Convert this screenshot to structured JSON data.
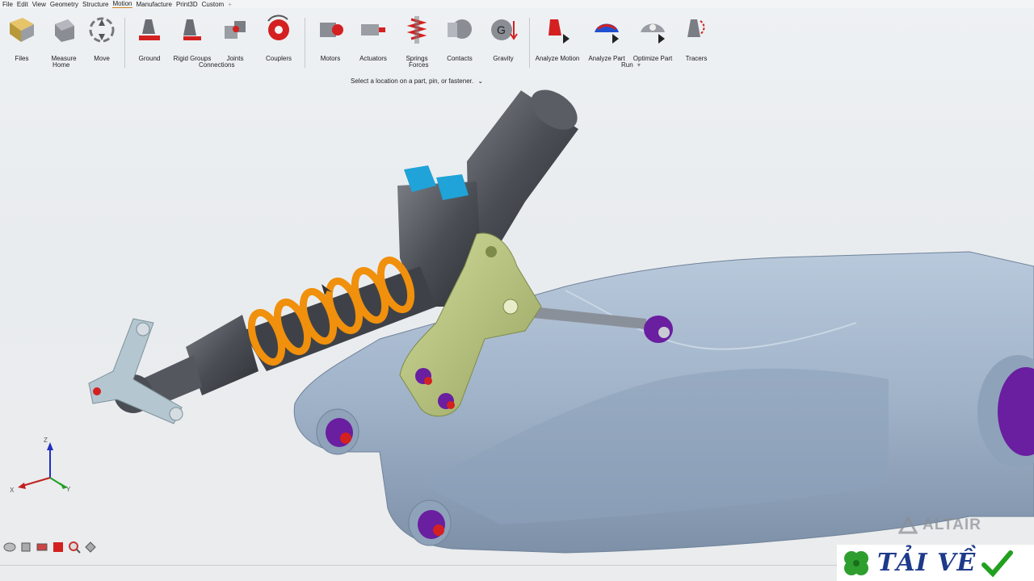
{
  "menu": [
    "File",
    "Edit",
    "View",
    "Geometry",
    "Structure",
    "Motion",
    "Manufacture",
    "Print3D",
    "Custom",
    "+"
  ],
  "active_menu": "Motion",
  "ribbon": {
    "tools": [
      {
        "label": "Files",
        "icon": "files-icon"
      },
      {
        "label": "Measure",
        "icon": "measure-icon"
      },
      {
        "label": "Move",
        "icon": "move-icon"
      },
      {
        "label": "Ground",
        "icon": "ground-icon"
      },
      {
        "label": "Rigid Groups",
        "icon": "rigid-groups-icon"
      },
      {
        "label": "Joints",
        "icon": "joints-icon"
      },
      {
        "label": "Couplers",
        "icon": "couplers-icon"
      },
      {
        "label": "Motors",
        "icon": "motors-icon"
      },
      {
        "label": "Actuators",
        "icon": "actuators-icon"
      },
      {
        "label": "Springs",
        "icon": "springs-icon"
      },
      {
        "label": "Contacts",
        "icon": "contacts-icon"
      },
      {
        "label": "Gravity",
        "icon": "gravity-icon"
      },
      {
        "label": "Analyze Motion",
        "icon": "analyze-motion-icon"
      },
      {
        "label": "Analyze Part",
        "icon": "analyze-part-icon"
      },
      {
        "label": "Optimize Part",
        "icon": "optimize-part-icon"
      },
      {
        "label": "Tracers",
        "icon": "tracers-icon"
      }
    ],
    "groups": {
      "home": "Home",
      "connections": "Connections",
      "forces": "Forces",
      "run": "Run"
    }
  },
  "hint": "Select a location on a part, pin, or fastener.",
  "brand": "ALTAIR",
  "watermark": "TẢI VỀ",
  "axes": {
    "z": "Z",
    "x": "X",
    "y": "Y"
  },
  "colors": {
    "spring": "#f0900c",
    "arm": "#9fb2c8",
    "bracket": "#b8c47a",
    "bushing": "#6a1ea0",
    "pin": "#d42020",
    "accent": "#d08020"
  }
}
